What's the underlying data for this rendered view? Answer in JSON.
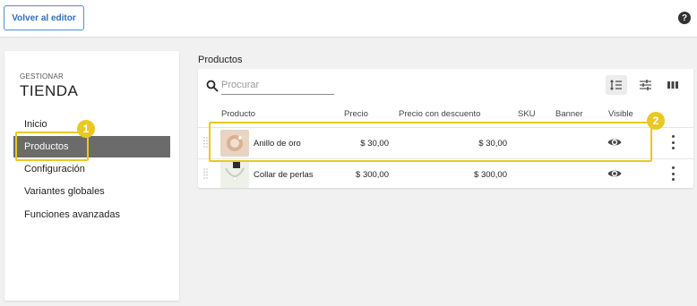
{
  "topbar": {
    "back_label": "Volver al editor",
    "help_icon": "question-circle-icon",
    "help_glyph": "?"
  },
  "sidebar": {
    "manage_label": "GESTIONAR",
    "store_label": "TIENDA",
    "items": [
      {
        "label": "Inicio"
      },
      {
        "label": "Productos"
      },
      {
        "label": "Configuración"
      },
      {
        "label": "Variantes globales"
      },
      {
        "label": "Funciones avanzadas"
      }
    ],
    "active_index": 1
  },
  "main": {
    "title": "Productos",
    "search": {
      "placeholder": "Procurar",
      "value": ""
    },
    "toolbar": {
      "icons": [
        "sort-list-icon",
        "filter-sliders-icon",
        "columns-icon"
      ]
    },
    "columns": [
      "Producto",
      "Precio",
      "Precio con descuento",
      "SKU",
      "Banner",
      "Visible"
    ],
    "rows": [
      {
        "name": "Anillo de oro",
        "price": "$ 30,00",
        "discount": "$ 30,00",
        "sku": "",
        "banner": "",
        "visible": true,
        "thumb_color": "#e5c9b4"
      },
      {
        "name": "Collar de perlas",
        "price": "$ 300,00",
        "discount": "$ 300,00",
        "sku": "",
        "banner": "",
        "visible": true,
        "thumb_color": "#e8ebe4"
      }
    ]
  },
  "annotations": {
    "badge_1": "1",
    "badge_2": "2",
    "color": "#e9c823"
  },
  "colors": {
    "accent_blue": "#2f6fba",
    "active_nav": "#6b6b6b",
    "highlight": "#e9c823"
  }
}
